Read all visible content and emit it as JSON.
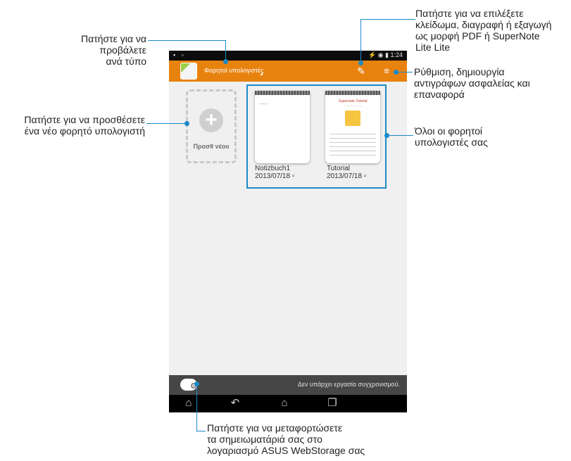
{
  "callouts": {
    "view_by_type": "Πατήστε για να προβάλετε\nανά τύπο",
    "add_new": "Πατήστε για να προσθέσετε\nένα νέο φορητό υπολογιστή",
    "lock_delete_export": "Πατήστε για να επιλέξετε\nκλείδωμα, διαγραφή ή εξαγωγή\nως μορφή PDF ή SuperNote\nLite Lite",
    "settings": "Ρύθμιση, δημιουργία\nαντιγράφων ασφαλείας και\nεπαναφορά",
    "all_notebooks": "Όλοι οι φορητοί\nυπολογιστές σας",
    "upload": "Πατήστε για να μεταφορτώσετε\nτα σημειωματάριά σας στο\nλογαριασμό ASUS WebStorage σας"
  },
  "status_bar": {
    "time": "1:24"
  },
  "action_bar": {
    "title": "Φορητοί υπολογιστές"
  },
  "add_new": {
    "label": "Προσθ νέου"
  },
  "notebooks": [
    {
      "name": "Notizbuch1",
      "date": "2013/07/18"
    },
    {
      "name": "Tutorial",
      "date": "2013/07/18",
      "cover_title": "Supernote Tutorial"
    }
  ],
  "bottom_bar": {
    "sync_status": "Δεν υπάρχει εργασία συγχρονισμού."
  },
  "colors": {
    "accent": "#e8820f",
    "callout_line": "#1a8ac8"
  }
}
